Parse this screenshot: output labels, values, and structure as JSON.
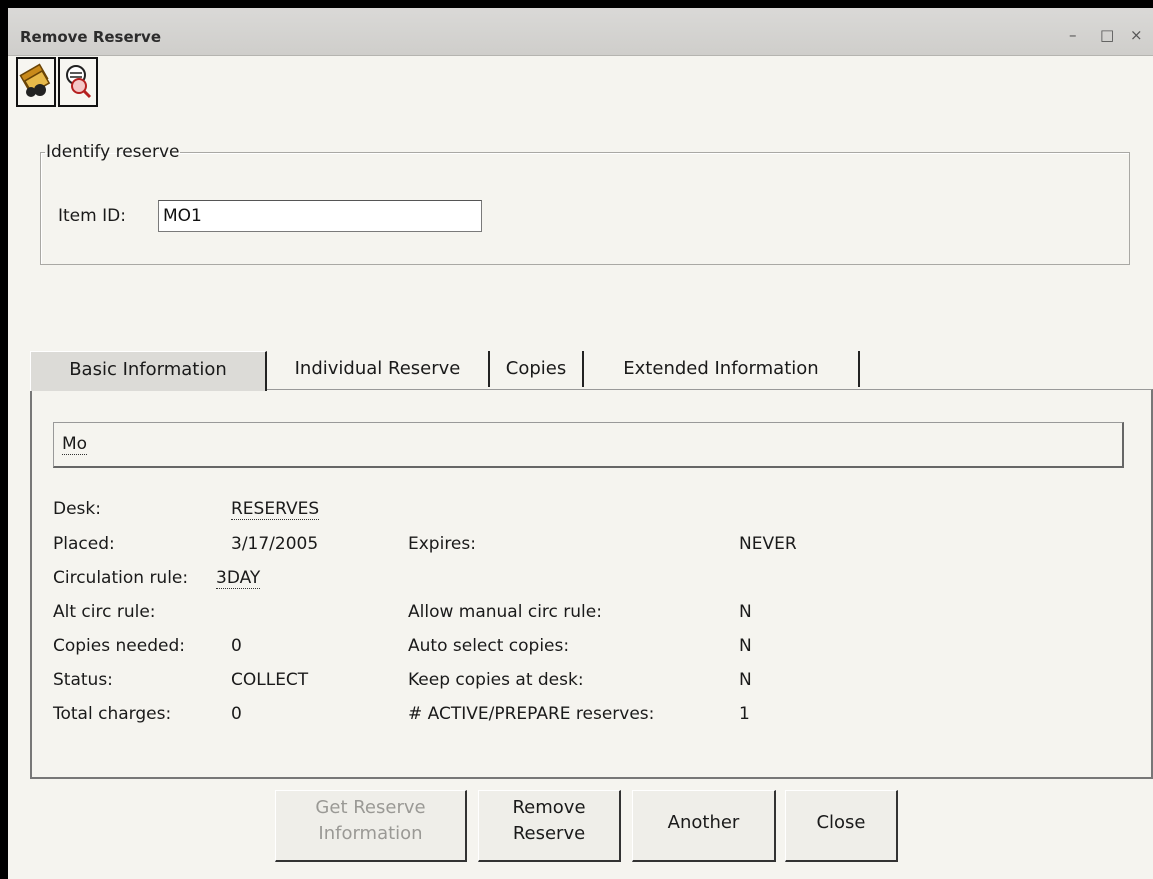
{
  "window": {
    "title": "Remove Reserve",
    "controls": {
      "minimize": "–",
      "maximize": "□",
      "close": "×"
    }
  },
  "toolbar": [
    {
      "icon": "item-search-icon"
    },
    {
      "icon": "user-lookup-icon"
    }
  ],
  "identify": {
    "legend": "Identify reserve",
    "item_id_label": "Item ID:",
    "item_id_value": "MO1"
  },
  "tabs": [
    {
      "label": "Basic Information",
      "active": true
    },
    {
      "label": "Individual Reserve",
      "active": false
    },
    {
      "label": "Copies",
      "active": false
    },
    {
      "label": "Extended Information",
      "active": false
    }
  ],
  "basic": {
    "title": "Mo",
    "desk_label": "Desk:",
    "desk": "RESERVES",
    "placed_label": "Placed:",
    "placed": "3/17/2005",
    "expires_label": "Expires:",
    "expires": "NEVER",
    "circ_rule_label": "Circulation rule:",
    "circ_rule": "3DAY",
    "alt_circ_label": "Alt circ rule:",
    "alt_circ": "",
    "allow_manual_label": "Allow manual circ rule:",
    "allow_manual": "N",
    "copies_needed_label": "Copies needed:",
    "copies_needed": "0",
    "auto_select_label": "Auto select copies:",
    "auto_select": "N",
    "status_label": "Status:",
    "status": "COLLECT",
    "keep_copies_label": "Keep copies at desk:",
    "keep_copies": "N",
    "total_charges_label": "Total charges:",
    "total_charges": "0",
    "active_prepare_label": "# ACTIVE/PREPARE reserves:",
    "active_prepare": "1"
  },
  "buttons": {
    "get_reserve": "Get Reserve\nInformation",
    "remove_reserve": "Remove\nReserve",
    "another": "Another",
    "close": "Close"
  }
}
